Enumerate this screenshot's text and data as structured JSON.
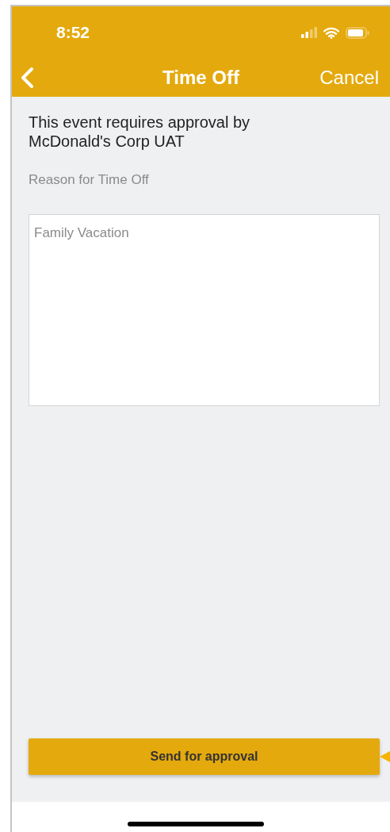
{
  "status_bar": {
    "time": "8:52"
  },
  "nav_bar": {
    "title": "Time Off",
    "action": "Cancel"
  },
  "notice": "This event requires approval by McDonald's Corp UAT",
  "reason_field": {
    "label": "Reason for Time Off",
    "placeholder": "Family Vacation"
  },
  "submit_button": "Send for approval"
}
